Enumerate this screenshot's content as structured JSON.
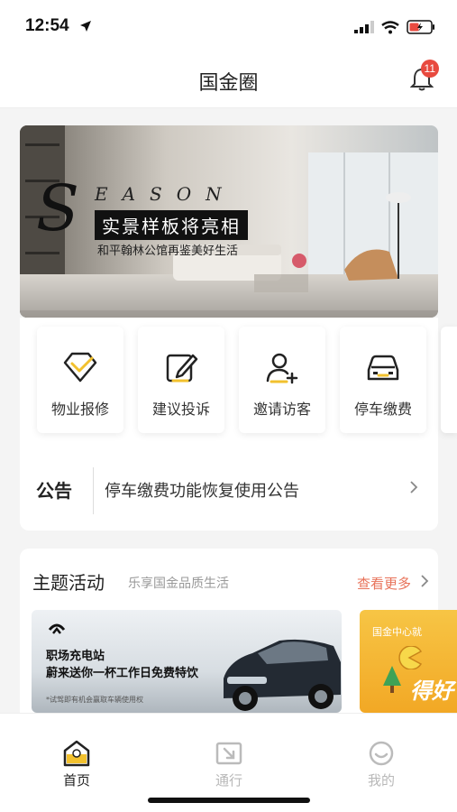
{
  "status_bar": {
    "time": "12:54"
  },
  "nav": {
    "title": "国金圈",
    "notification_count": "11"
  },
  "banner": {
    "headline": "实景样板将亮相",
    "subline": "和平翰林公馆再鉴美好生活",
    "brand_word": "EASON",
    "brand_initial": "S"
  },
  "quick_actions": [
    {
      "label": "物业报修",
      "icon": "diamond-check-icon"
    },
    {
      "label": "建议投诉",
      "icon": "edit-icon"
    },
    {
      "label": "邀请访客",
      "icon": "add-user-icon"
    },
    {
      "label": "停车缴费",
      "icon": "car-icon"
    }
  ],
  "notice": {
    "tag": "公告",
    "text": "停车缴费功能恢复使用公告"
  },
  "activities": {
    "title": "主题活动",
    "subtitle": "乐享国金品质生活",
    "more_label": "查看更多",
    "cards": [
      {
        "line1": "职场充电站",
        "line2": "蔚来送你一杯工作日免费特饮",
        "footnote": "*试驾即有机会赢取车辆使用权"
      },
      {
        "header": "国金中心就",
        "big": "得好"
      }
    ]
  },
  "tabbar": {
    "tabs": [
      {
        "label": "首页",
        "active": true
      },
      {
        "label": "通行",
        "active": false
      },
      {
        "label": "我的",
        "active": false
      }
    ]
  },
  "colors": {
    "accent": "#f2c12e",
    "badge": "#e84a3f",
    "more": "#e8735a",
    "inactive": "#b8b8b8"
  }
}
